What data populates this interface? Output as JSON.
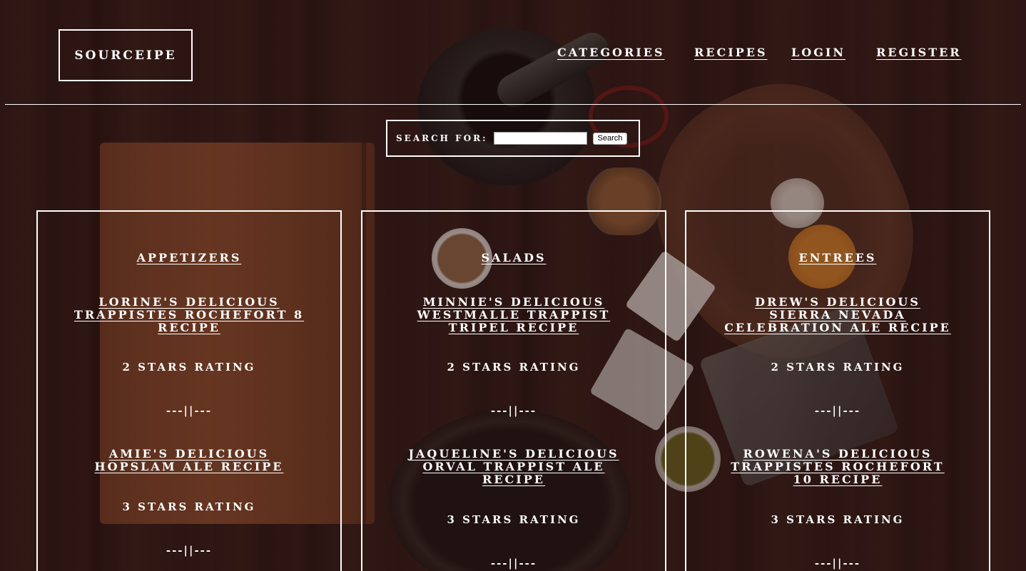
{
  "header": {
    "logo": "SOURCEIPE",
    "nav": [
      "CATEGORIES",
      "RECIPES",
      "LOGIN",
      "REGISTER"
    ]
  },
  "search": {
    "label": "SEARCH FOR:",
    "value": "",
    "button": "Search"
  },
  "categories": [
    {
      "title": "APPETIZERS",
      "recipes": [
        {
          "title": "LORINE'S DELICIOUS TRAPPISTES ROCHEFORT 8 RECIPE",
          "rating": "2 STARS RATING"
        },
        {
          "title": "AMIE'S DELICIOUS HOPSLAM ALE RECIPE",
          "rating": "3 STARS RATING"
        }
      ]
    },
    {
      "title": "SALADS",
      "recipes": [
        {
          "title": "MINNIE'S DELICIOUS WESTMALLE TRAPPIST TRIPEL RECIPE",
          "rating": "2 STARS RATING"
        },
        {
          "title": "JAQUELINE'S DELICIOUS ORVAL TRAPPIST ALE RECIPE",
          "rating": "3 STARS RATING"
        }
      ]
    },
    {
      "title": "ENTREES",
      "recipes": [
        {
          "title": "DREW'S DELICIOUS SIERRA NEVADA CELEBRATION ALE RECIPE",
          "rating": "2 STARS RATING"
        },
        {
          "title": "ROWENA'S DELICIOUS TRAPPISTES ROCHEFORT 10 RECIPE",
          "rating": "3 STARS RATING"
        }
      ]
    }
  ],
  "separator": "---||---"
}
